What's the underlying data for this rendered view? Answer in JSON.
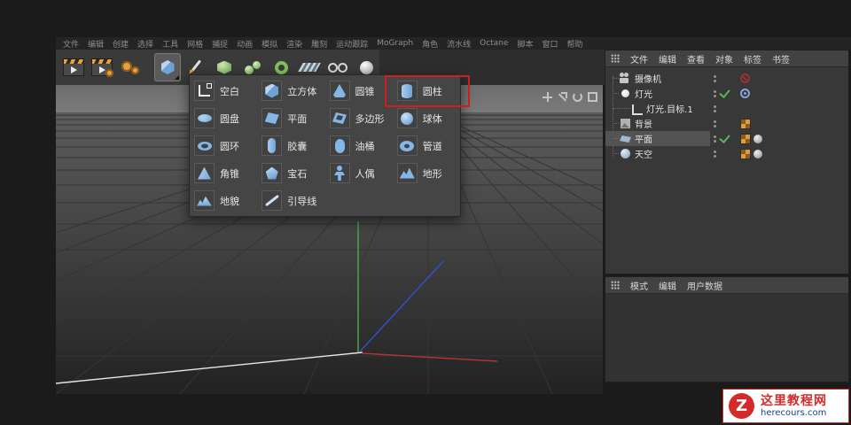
{
  "menubar": {
    "items": [
      "文件",
      "编辑",
      "创建",
      "选择",
      "工具",
      "网格",
      "捕捉",
      "动画",
      "模拟",
      "渲染",
      "雕刻",
      "运动跟踪",
      "MoGraph",
      "角色",
      "流水线",
      "Octane",
      "脚本",
      "窗口",
      "帮助"
    ]
  },
  "toolbar": {
    "icons": [
      "render-view-icon",
      "render-settings-icon",
      "interactive-render-icon",
      "primitive-cube-icon",
      "pen-tool-icon",
      "subdivision-surface-icon",
      "cloner-icon",
      "deformer-icon",
      "floor-icon",
      "environment-rings-icon",
      "material-sphere-icon"
    ]
  },
  "primitives_menu": {
    "highlight_color": "#cc1f1f",
    "items": [
      {
        "label": "空白",
        "icon": "null-icon"
      },
      {
        "label": "立方体",
        "icon": "cube-icon"
      },
      {
        "label": "圆锥",
        "icon": "cone-icon"
      },
      {
        "label": "圆柱",
        "icon": "cylinder-icon",
        "highlighted": true
      },
      {
        "label": "圆盘",
        "icon": "disc-icon"
      },
      {
        "label": "平面",
        "icon": "plane-icon"
      },
      {
        "label": "多边形",
        "icon": "polygon-icon"
      },
      {
        "label": "球体",
        "icon": "sphere-icon"
      },
      {
        "label": "圆环",
        "icon": "torus-icon"
      },
      {
        "label": "胶囊",
        "icon": "capsule-icon"
      },
      {
        "label": "油桶",
        "icon": "oil-tank-icon"
      },
      {
        "label": "管道",
        "icon": "tube-icon"
      },
      {
        "label": "角锥",
        "icon": "pyramid-icon"
      },
      {
        "label": "宝石",
        "icon": "platonic-icon"
      },
      {
        "label": "人偶",
        "icon": "figure-icon"
      },
      {
        "label": "地形",
        "icon": "landscape-icon"
      },
      {
        "label": "地貌",
        "icon": "relief-icon"
      },
      {
        "label": "引导线",
        "icon": "guide-icon"
      }
    ]
  },
  "viewport": {
    "overlay_icons": [
      "pan-icon",
      "dolly-icon",
      "rotate-icon",
      "toggle-view-icon"
    ],
    "axis_colors": {
      "x": "#b03434",
      "y": "#4aa54a",
      "z": "#3050c8"
    },
    "colors": {
      "sky": "#737373",
      "ground_top": "#5d5d5d",
      "ground_bottom": "#222222"
    }
  },
  "object_manager": {
    "tabs": [
      "文件",
      "编辑",
      "查看",
      "对象",
      "标签",
      "书签"
    ],
    "objects": [
      {
        "label": "摄像机",
        "icon": "camera-object-icon",
        "visibility": "dots",
        "tags": [
          "disabled-icon"
        ]
      },
      {
        "label": "灯光",
        "icon": "light-object-icon",
        "visibility": "check",
        "tags": [
          "target-tag-icon"
        ]
      },
      {
        "label": "灯光.目标.1",
        "icon": "null-axis-icon",
        "visibility": "dots",
        "tags": []
      },
      {
        "label": "背景",
        "icon": "background-object-icon",
        "visibility": "dots",
        "tags": [
          "texture-tag-icon"
        ]
      },
      {
        "label": "平面",
        "icon": "plane-object-icon",
        "visibility": "check",
        "selected": true,
        "tags": [
          "texture-tag-icon",
          "phong-tag-icon"
        ]
      },
      {
        "label": "天空",
        "icon": "sky-object-icon",
        "visibility": "dots",
        "tags": [
          "texture-tag-icon",
          "phong-tag-icon"
        ]
      }
    ]
  },
  "attribute_manager": {
    "tabs": [
      "模式",
      "编辑",
      "用户数据"
    ]
  },
  "watermark": {
    "logo_letter": "Z",
    "title": "这里教程网",
    "url": "herecours.com",
    "accent_color": "#d42a2a"
  }
}
